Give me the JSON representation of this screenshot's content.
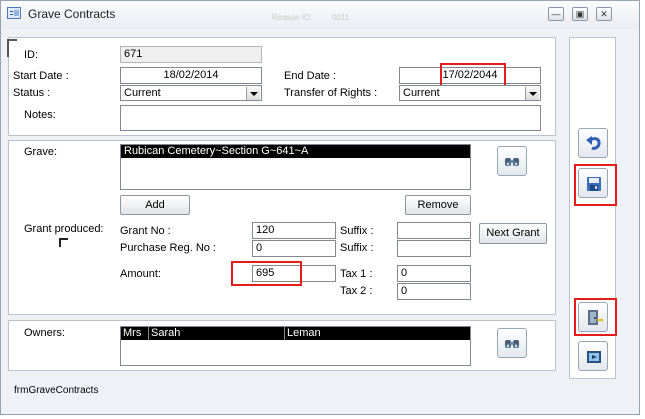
{
  "window": {
    "title": "Grave Contracts",
    "faded_label": "Reason ID:",
    "faded_value": "0011"
  },
  "form": {
    "id_label": "ID:",
    "id_value": "671",
    "start_date_label": "Start Date :",
    "start_date_value": "18/02/2014",
    "end_date_label": "End Date :",
    "end_date_value": "17/02/2044",
    "status_label": "Status :",
    "status_value": "Current",
    "transfer_label": "Transfer of Rights :",
    "transfer_value": "Current",
    "notes_label": "Notes:",
    "notes_value": ""
  },
  "grave": {
    "label": "Grave:",
    "selected_item": "Rubican Cemetery~Section G~641~A",
    "add_label": "Add",
    "remove_label": "Remove",
    "grant_produced_label": "Grant produced:",
    "grant_no_label": "Grant No :",
    "grant_no_value": "120",
    "suffix_label": "Suffix :",
    "suffix_value": "",
    "purchase_reg_label": "Purchase Reg. No :",
    "purchase_reg_value": "0",
    "suffix2_label": "Suffix :",
    "suffix2_value": "",
    "next_grant_label": "Next Grant",
    "amount_label": "Amount:",
    "amount_value": "695",
    "tax1_label": "Tax 1 :",
    "tax1_value": "0",
    "tax2_label": "Tax 2 :",
    "tax2_value": "0"
  },
  "owners": {
    "label": "Owners:",
    "rows": [
      {
        "title": "Mrs",
        "first_name": "Sarah",
        "last_name": "Leman"
      }
    ]
  },
  "footer": {
    "form_name": "frmGraveContracts"
  },
  "icons": {
    "undo": "undo-icon",
    "save": "save-icon",
    "exit": "exit-door-icon",
    "preview": "preview-icon",
    "lookup": "binoculars-icon"
  },
  "colors": {
    "highlight": "#e31c1c",
    "selection": "#000000",
    "undo_arrow": "#2f5fb3"
  }
}
